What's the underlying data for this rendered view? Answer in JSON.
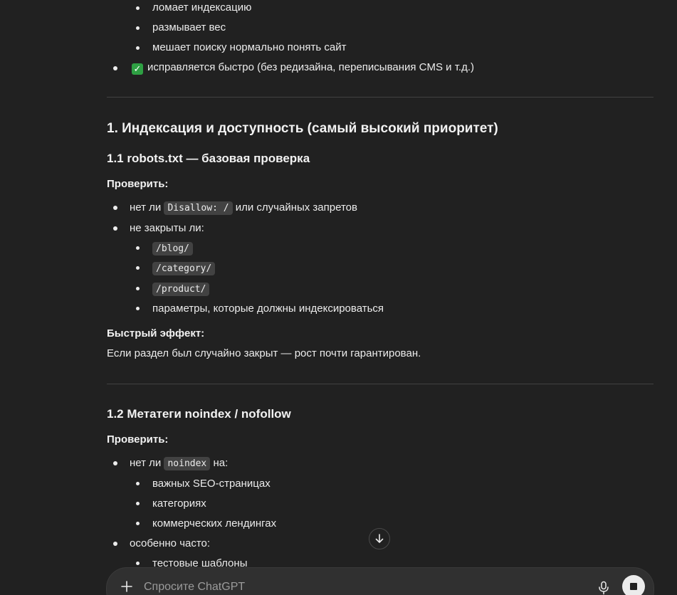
{
  "conversation": {
    "prev_list": {
      "sub_items": [
        "ломает индексацию",
        "размывает вес",
        "мешает поиску нормально понять сайт"
      ],
      "check_item": {
        "icon": "check-mark-icon",
        "icon_color": "#2ea043",
        "text": "исправляется быстро (без редизайна, переписывания CMS и т.д.)"
      }
    },
    "section1": {
      "heading": "1. Индексация и доступность (самый высокий приоритет)",
      "sub1": {
        "heading": "1.1 robots.txt — базовая проверка",
        "check_label": "Проверить:",
        "item1_prefix": "нет ли",
        "item1_code": "Disallow: /",
        "item1_suffix": "или случайных запретов",
        "item2": "не закрыты ли:",
        "item2_codes": [
          "/blog/",
          "/category/",
          "/product/"
        ],
        "item2_last": "параметры, которые должны индексироваться",
        "effect_label": "Быстрый эффект:",
        "effect_text": "Если раздел был случайно закрыт — рост почти гарантирован."
      },
      "sub2": {
        "heading": "1.2 Метатеги noindex / nofollow",
        "check_label": "Проверить:",
        "item1_prefix": "нет ли",
        "item1_code": "noindex",
        "item1_suffix": "на:",
        "item1_subs": [
          "важных SEO-страницах",
          "категориях",
          "коммерческих лендингах"
        ],
        "item2": "особенно часто:",
        "item2_subs": [
          "тестовые шаблоны"
        ]
      }
    }
  },
  "scroll_button": {
    "icon": "arrow-down-icon"
  },
  "composer": {
    "placeholder": "Спросите ChatGPT",
    "value": "",
    "plus_icon": "plus-icon",
    "mic_icon": "microphone-icon",
    "stop_icon": "stop-icon"
  }
}
